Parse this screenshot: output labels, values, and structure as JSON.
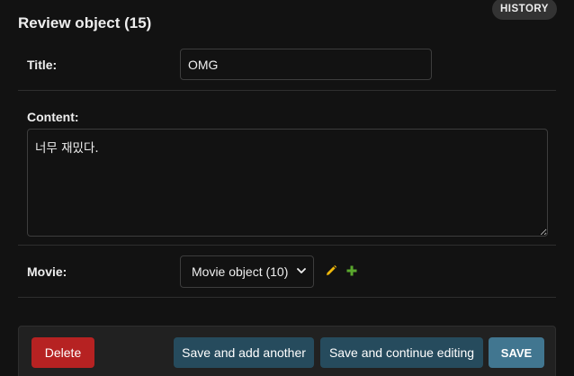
{
  "header": {
    "title": "Review object (15)",
    "history_label": "HISTORY"
  },
  "form": {
    "title": {
      "label": "Title:",
      "value": "OMG"
    },
    "content": {
      "label": "Content:",
      "value": "너무 재밌다."
    },
    "movie": {
      "label": "Movie:",
      "selected": "Movie object (10)",
      "edit_icon": "pencil-icon",
      "add_icon": "plus-icon"
    }
  },
  "submit_row": {
    "delete_label": "Delete",
    "save_add_another_label": "Save and add another",
    "save_continue_label": "Save and continue editing",
    "save_label": "SAVE"
  },
  "colors": {
    "background": "#121212",
    "delete": "#b62222",
    "secondary_button": "#264b5d",
    "primary_button": "#417690",
    "edit_icon": "#efb80b",
    "add_icon": "#5aa82d"
  }
}
